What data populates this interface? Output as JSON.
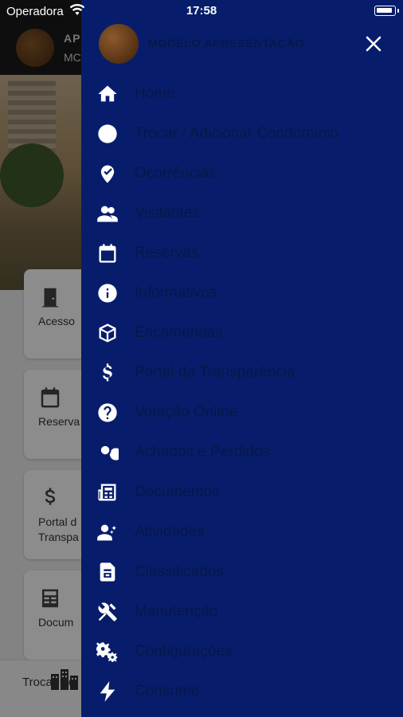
{
  "status_bar": {
    "carrier": "Operadora",
    "time": "17:58"
  },
  "background": {
    "header_title": "AP",
    "header_subtitle": "MC",
    "cards": [
      {
        "icon": "door-icon",
        "label": "Acesso"
      },
      {
        "icon": "calendar-icon",
        "label": "Reserva"
      },
      {
        "icon": "dollar-icon",
        "label": "Portal d\nTranspa"
      },
      {
        "icon": "newspaper-icon",
        "label": "Docum"
      }
    ],
    "bottom_label": "Trocar Co"
  },
  "drawer": {
    "title": "MODELO APRESENTAÇÃO",
    "items": [
      {
        "label": "Home",
        "icon": "home-icon"
      },
      {
        "label": "Trocar / Adicionar Condomínio",
        "icon": "swap-icon"
      },
      {
        "label": "Ocorrências",
        "icon": "checkmark-pin-icon"
      },
      {
        "label": "Visitantes",
        "icon": "people-icon"
      },
      {
        "label": "Reservas",
        "icon": "calendar-icon"
      },
      {
        "label": "Informativos",
        "icon": "info-icon"
      },
      {
        "label": "Encomendas",
        "icon": "package-icon"
      },
      {
        "label": "Portal da Transparência",
        "icon": "dollar-icon"
      },
      {
        "label": "Votação Online",
        "icon": "question-icon"
      },
      {
        "label": "Achados e Perdidos",
        "icon": "search-icon"
      },
      {
        "label": "Documentos",
        "icon": "newspaper-icon"
      },
      {
        "label": "Atividades",
        "icon": "people-sparkle-icon"
      },
      {
        "label": "Classificados",
        "icon": "document-icon"
      },
      {
        "label": "Manutenção",
        "icon": "tools-icon"
      },
      {
        "label": "Configurações",
        "icon": "gears-icon"
      },
      {
        "label": "Consumo",
        "icon": "lightning-icon"
      }
    ]
  },
  "colors": {
    "drawer_background": "#071d6b",
    "menu_text": "#061848",
    "icon": "#ffffff"
  }
}
